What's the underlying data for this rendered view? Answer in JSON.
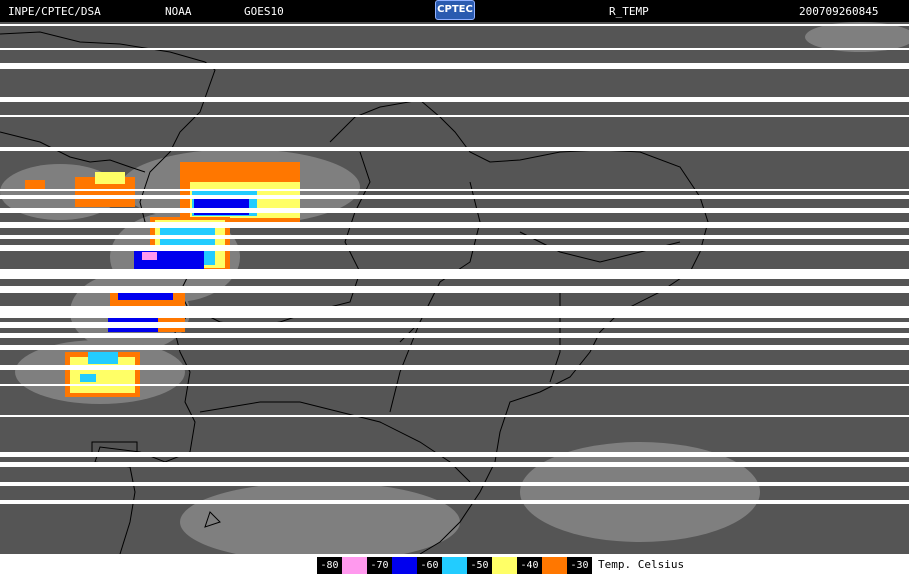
{
  "header": {
    "institution": "INPE/CPTEC/DSA",
    "agency": "NOAA",
    "satellite": "GOES10",
    "logo_text": "CPTEC",
    "product": "R_TEMP",
    "timestamp": "200709260845"
  },
  "legend": {
    "title": "Temp. Celsius",
    "items": [
      {
        "label": "-80",
        "color": "#ff99ee"
      },
      {
        "label": "-70",
        "color": "#0000ee"
      },
      {
        "label": "-60",
        "color": "#22ccff"
      },
      {
        "label": "-50",
        "color": "#ffff66"
      },
      {
        "label": "-40",
        "color": "#ff7700"
      },
      {
        "label": "-30",
        "color": ""
      }
    ]
  },
  "map": {
    "background_color": "#555555",
    "scanline_color": "#ffffff",
    "border_color": "#000000"
  }
}
